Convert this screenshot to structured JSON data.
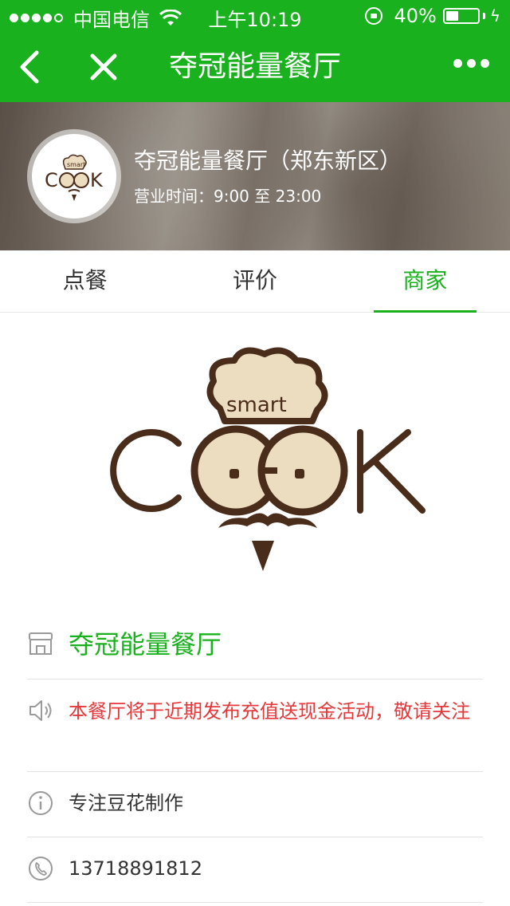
{
  "status_bar": {
    "carrier": "中国电信",
    "time": "上午10:19",
    "battery_percent": "40%",
    "battery_level": 0.4,
    "signal_bars_filled": 4,
    "signal_bars_total": 5
  },
  "nav": {
    "title": "夺冠能量餐厅",
    "back_icon": "chevron-left-icon",
    "close_icon": "close-icon",
    "more_icon": "more-dots-icon"
  },
  "banner": {
    "restaurant_name": "夺冠能量餐厅（郑东新区）",
    "hours": "营业时间：9:00 至 23:00"
  },
  "tabs": [
    {
      "label": "点餐",
      "active": false
    },
    {
      "label": "评价",
      "active": false
    },
    {
      "label": "商家",
      "active": true
    }
  ],
  "logo": {
    "hat_text": "smart",
    "brand_text": "COOK",
    "colors": {
      "outline": "#4a2c1a",
      "fill": "#ecdcc0"
    }
  },
  "info": {
    "name": "夺冠能量餐厅",
    "notice": "本餐厅将于近期发布充值送现金活动，敬请关注",
    "description": "专注豆花制作",
    "phone": "13718891812"
  },
  "colors": {
    "brand_green": "#19b11d",
    "notice_red": "#e5383b",
    "divider": "#e2e2e2"
  }
}
